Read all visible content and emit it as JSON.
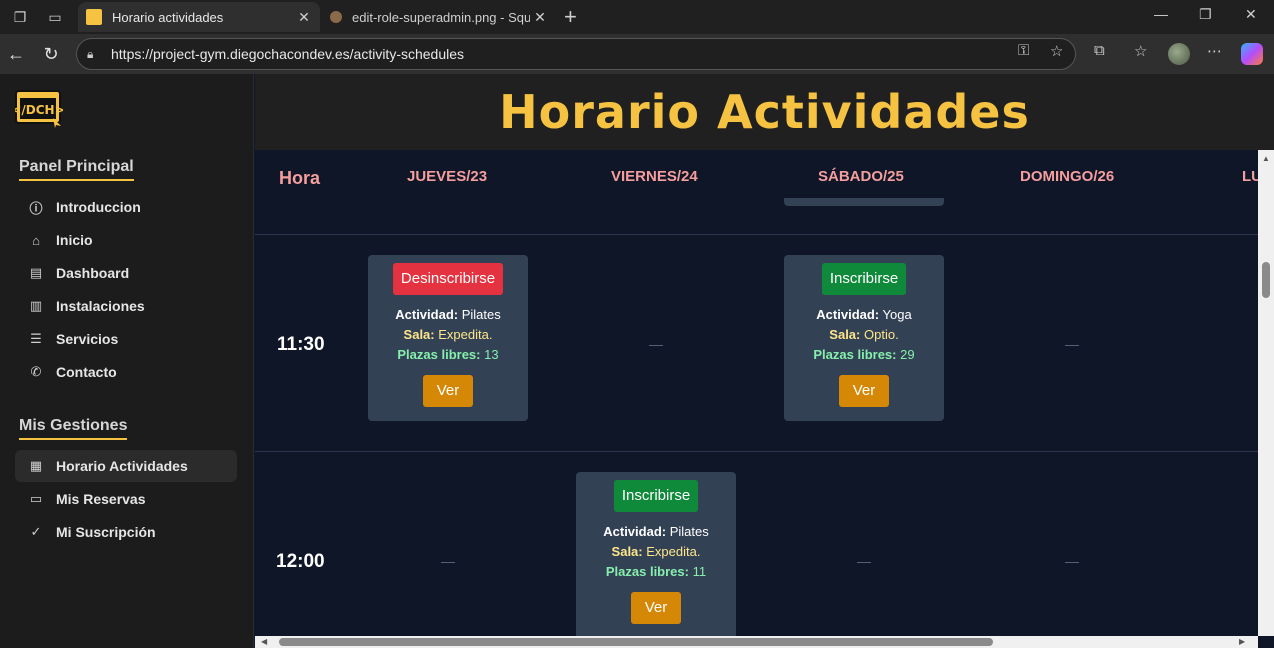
{
  "browser": {
    "tabs": [
      {
        "title": "Horario actividades",
        "active": true
      },
      {
        "title": "edit-role-superadmin.png - Squoo",
        "active": false
      }
    ],
    "url": "https://project-gym.diegochacondev.es/activity-schedules"
  },
  "sidebar": {
    "logo_text": "</DCH>",
    "section_main": "Panel Principal",
    "main_items": [
      {
        "label": "Introduccion",
        "icon": "info-icon"
      },
      {
        "label": "Inicio",
        "icon": "home-icon"
      },
      {
        "label": "Dashboard",
        "icon": "dashboard-icon"
      },
      {
        "label": "Instalaciones",
        "icon": "building-icon"
      },
      {
        "label": "Servicios",
        "icon": "list-icon"
      },
      {
        "label": "Contacto",
        "icon": "phone-icon"
      }
    ],
    "section_manage": "Mis Gestiones",
    "manage_items": [
      {
        "label": "Horario Actividades",
        "icon": "calendar-icon",
        "active": true
      },
      {
        "label": "Mis Reservas",
        "icon": "ticket-icon"
      },
      {
        "label": "Mi Suscripción",
        "icon": "check-circle-icon"
      }
    ]
  },
  "page": {
    "title": "Horario Actividades",
    "columns": [
      "Hora",
      "JUEVES/23",
      "VIERNES/24",
      "SÁBADO/25",
      "DOMINGO/26",
      "LU"
    ],
    "empty_mark": "—",
    "labels": {
      "actividad": "Actividad:",
      "sala": "Sala:",
      "plazas": "Plazas libres:",
      "ver": "Ver"
    },
    "rows": [
      {
        "time": "11:30",
        "cards": [
          {
            "day": "JUEVES/23",
            "action": "Desinscribirse",
            "actividad": "Pilates",
            "sala": "Expedita.",
            "plazas": "13"
          },
          {
            "day": "SÁBADO/25",
            "action": "Inscribirse",
            "actividad": "Yoga",
            "sala": "Optio.",
            "plazas": "29"
          }
        ]
      },
      {
        "time": "12:00",
        "cards": [
          {
            "day": "VIERNES/24",
            "action": "Inscribirse",
            "actividad": "Pilates",
            "sala": "Expedita.",
            "plazas": "11"
          }
        ]
      }
    ]
  },
  "colors": {
    "accent": "#f5c242",
    "header_text": "#f59e9e",
    "btn_red": "#e53241",
    "btn_green": "#0f8a3a",
    "btn_ver": "#d48806",
    "card_bg": "#334155",
    "main_bg": "#0f1628"
  }
}
